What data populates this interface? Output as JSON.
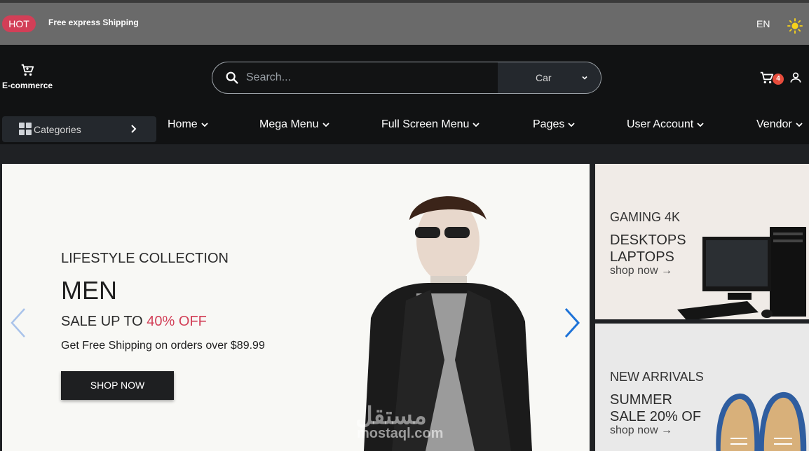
{
  "topbar": {
    "hot_label": "HOT",
    "promo_text": "Free express Shipping",
    "language": "EN",
    "theme_icon": "sun-icon"
  },
  "header": {
    "logo_icon": "cart-icon",
    "logo_text": "E-commerce",
    "search": {
      "placeholder": "Search...",
      "category_selected": "Car"
    },
    "cart_count": "4",
    "user_icon": "user-icon"
  },
  "nav": {
    "categories_label": "Categories",
    "items": [
      {
        "label": "Home"
      },
      {
        "label": "Mega Menu"
      },
      {
        "label": "Full Screen Menu"
      },
      {
        "label": "Pages"
      },
      {
        "label": "User Account"
      },
      {
        "label": "Vendor"
      }
    ]
  },
  "hero": {
    "subtitle": "LIFESTYLE COLLECTION",
    "title": "MEN",
    "sale_prefix": "SALE UP TO",
    "sale_value": "40% OFF",
    "shipping_text": "Get Free Shipping on orders over $89.99",
    "button_label": "SHOP NOW",
    "watermark": "مستقل",
    "watermark_sub": "mostaql.com"
  },
  "promos": [
    {
      "kicker": "GAMING 4K",
      "title_line1": "DESKTOPS",
      "title_line2": "LAPTOPS",
      "link": "shop now →"
    },
    {
      "kicker": "NEW ARRIVALS",
      "title_line1": "SUMMER",
      "title_line2": "SALE 20% OF",
      "link": "shop now →"
    }
  ],
  "colors": {
    "accent": "#d23f57",
    "topbar": "#6a6a6a",
    "header": "#111213",
    "arrow": "#1e73d8"
  }
}
